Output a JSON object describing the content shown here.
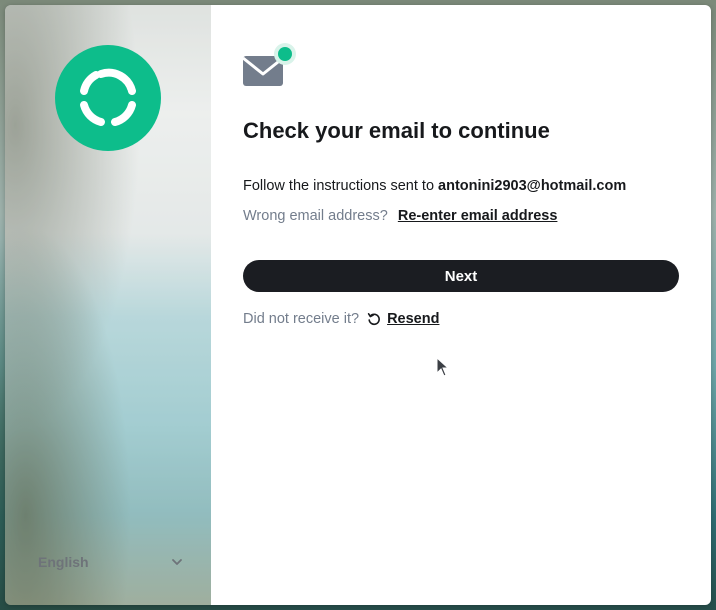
{
  "sidebar": {
    "language": "English"
  },
  "main": {
    "title": "Check your email to continue",
    "instructions_prefix": "Follow the instructions sent to",
    "email": "antonini2903@hotmail.com",
    "wrong_email_text": "Wrong email address?",
    "reenter_link": "Re-enter email address",
    "next_button": "Next",
    "not_received_text": "Did not receive it?",
    "resend_link": "Resend"
  },
  "icons": {
    "logo": "element-logo-icon",
    "mail": "mail-notification-icon",
    "resend": "refresh-icon",
    "language_chevron": "chevron-down-icon"
  },
  "colors": {
    "brand_green": "#0dbd8b",
    "button_bg": "#1b1d22",
    "text_primary": "#17191c",
    "text_secondary": "#737d8c"
  }
}
